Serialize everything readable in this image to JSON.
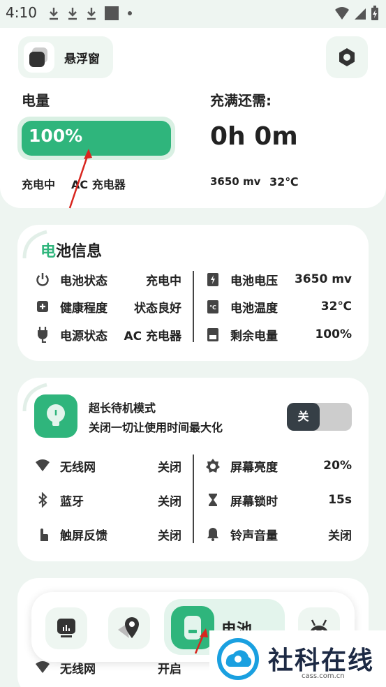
{
  "status_bar": {
    "time": "4:10"
  },
  "top": {
    "float_label": "悬浮窗",
    "battery_label": "电量",
    "battery_percent": "100%",
    "battery_level": 1.0,
    "full_label": "充满还需:",
    "full_time": "0h 0m",
    "charging_status": "充电中",
    "charger": "AC 充电器",
    "voltage": "3650 mv",
    "temperature": "32℃"
  },
  "battery_info": {
    "title_accent": "电",
    "title_rest": "池信息",
    "left": [
      {
        "label": "电池状态",
        "value": "充电中",
        "icon": "power-icon"
      },
      {
        "label": "健康程度",
        "value": "状态良好",
        "icon": "health-icon"
      },
      {
        "label": "电源状态",
        "value": "AC 充电器",
        "icon": "plug-icon"
      }
    ],
    "right": [
      {
        "label": "电池电压",
        "value": "3650 mv",
        "icon": "voltage-icon"
      },
      {
        "label": "电池温度",
        "value": "32℃",
        "icon": "temperature-icon"
      },
      {
        "label": "剩余电量",
        "value": "100%",
        "icon": "battery-icon"
      }
    ]
  },
  "standby": {
    "title": "超长待机模式",
    "subtitle": "关闭一切让使用时间最大化",
    "toggle_label": "关",
    "left": [
      {
        "label": "无线网",
        "value": "关闭",
        "icon": "wifi-icon"
      },
      {
        "label": "蓝牙",
        "value": "关闭",
        "icon": "bluetooth-icon"
      },
      {
        "label": "触屏反馈",
        "value": "关闭",
        "icon": "touch-icon"
      }
    ],
    "right": [
      {
        "label": "屏幕亮度",
        "value": "20%",
        "icon": "brightness-icon"
      },
      {
        "label": "屏幕锁时",
        "value": "15s",
        "icon": "hourglass-icon"
      },
      {
        "label": "铃声音量",
        "value": "关闭",
        "icon": "bell-icon"
      }
    ]
  },
  "bottom_partial": {
    "wifi_label": "无线网",
    "wifi_value": "开启"
  },
  "nav": {
    "battery_label": "电池"
  },
  "watermark": {
    "text": "社科在线",
    "sub": "cass.com.cn"
  },
  "colors": {
    "accent": "#2fb57c",
    "background": "#eef5f1"
  }
}
